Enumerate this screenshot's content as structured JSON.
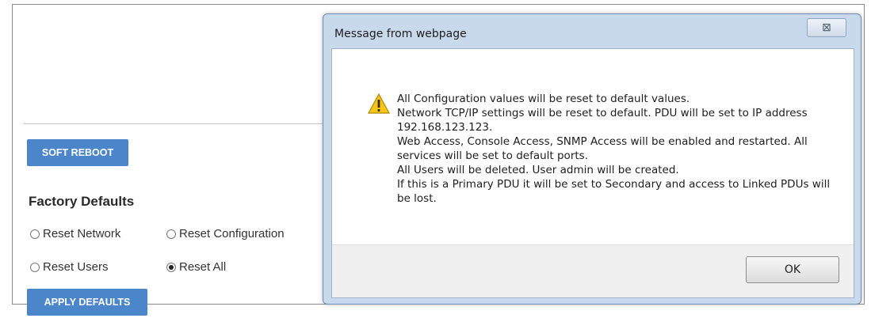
{
  "page": {
    "soft_reboot_label": "SOFT REBOOT",
    "factory_defaults_title": "Factory Defaults",
    "options": [
      {
        "label": "Reset Network",
        "checked": false
      },
      {
        "label": "Reset Configuration",
        "checked": false
      },
      {
        "label": "Reset Users",
        "checked": false
      },
      {
        "label": "Reset All",
        "checked": true
      }
    ],
    "apply_defaults_label": "APPLY DEFAULTS",
    "accent_color": "#4a86c9"
  },
  "dialog": {
    "title": "Message from webpage",
    "close_glyph": "⊠",
    "icon": "warning-icon",
    "lines": [
      "All Configuration values will be reset to default values.",
      "Network TCP/IP settings will be reset to default.  PDU will be set to IP address 192.168.123.123.",
      "Web Access, Console Access, SNMP Access will be enabled and restarted.  All services will be set to default ports.",
      "All Users will be deleted.  User admin will be created.",
      "If this is a Primary PDU it will be set to Secondary and access to Linked PDUs will be lost."
    ],
    "ok_label": "OK"
  }
}
